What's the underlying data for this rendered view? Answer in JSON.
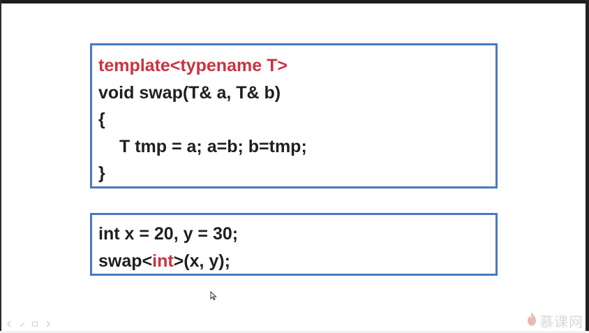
{
  "code_block_1": {
    "line1": "template<typename T>",
    "line2": "void swap(T& a, T& b)",
    "line3": "{",
    "line4": "T tmp = a; a=b; b=tmp;",
    "line5": "}"
  },
  "code_block_2": {
    "line1": "int x = 20, y = 30;",
    "line2_prefix": "swap<",
    "line2_highlight": "int",
    "line2_suffix": ">(x, y);"
  },
  "watermark": {
    "text": "慕课网",
    "icon": "flame-icon"
  },
  "toolbar": {
    "icons": [
      "back-arrow-icon",
      "pen-icon",
      "slides-icon",
      "forward-arrow-icon"
    ]
  },
  "colors": {
    "border": "#4a78c2",
    "keyword": "#c9343f",
    "text": "#1f1f1f"
  }
}
